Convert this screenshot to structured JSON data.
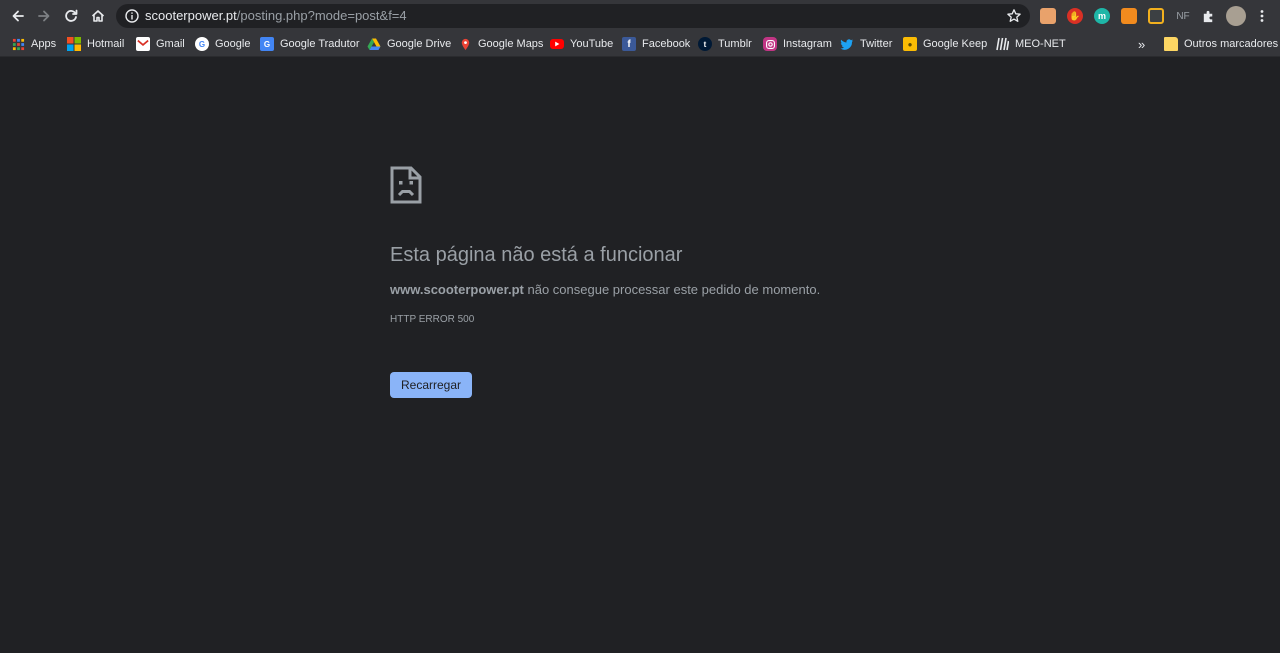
{
  "browser": {
    "url_host": "scooterpower.pt",
    "url_path": "/posting.php?mode=post&f=4",
    "profile_initials": "NF",
    "icons": [
      "back-arrow-icon",
      "forward-arrow-icon",
      "reload-icon",
      "home-icon",
      "info-icon",
      "star-icon",
      "puzzle-icon",
      "menu-kebab-icon"
    ]
  },
  "bookmarks": {
    "items": [
      {
        "label": "Apps",
        "icon": "apps-grid-icon"
      },
      {
        "label": "Hotmail",
        "icon": "hotmail-icon"
      },
      {
        "label": "Gmail",
        "icon": "gmail-icon"
      },
      {
        "label": "Google",
        "icon": "google-icon"
      },
      {
        "label": "Google Tradutor",
        "icon": "translate-icon"
      },
      {
        "label": "Google Drive",
        "icon": "drive-icon"
      },
      {
        "label": "Google Maps",
        "icon": "maps-icon"
      },
      {
        "label": "YouTube",
        "icon": "youtube-icon"
      },
      {
        "label": "Facebook",
        "icon": "facebook-icon"
      },
      {
        "label": "Tumblr",
        "icon": "tumblr-icon"
      },
      {
        "label": "Instagram",
        "icon": "instagram-icon"
      },
      {
        "label": "Twitter",
        "icon": "twitter-icon"
      },
      {
        "label": "Google Keep",
        "icon": "keep-icon"
      },
      {
        "label": "MEO-NET",
        "icon": "meo-icon"
      }
    ],
    "overflow": "»",
    "other_folder": "Outros marcadores"
  },
  "error": {
    "title": "Esta página não está a funcionar",
    "host": "www.scooterpower.pt",
    "message": " não consegue processar este pedido de momento.",
    "code": "HTTP ERROR 500",
    "reload_label": "Recarregar"
  },
  "colors": {
    "page_background": "#202124",
    "toolbar": "#35363a",
    "text_muted": "#9aa0a6",
    "accent": "#8ab4f8"
  }
}
